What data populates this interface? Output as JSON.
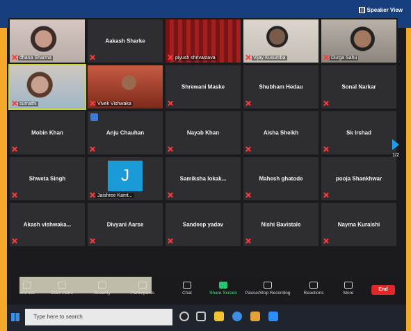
{
  "header": {
    "speaker_view_label": "Speaker View"
  },
  "tiles": [
    {
      "name": "dhana Sharma",
      "style": "vid1",
      "label_pos": "bottom"
    },
    {
      "name": "Aakash Sharke",
      "style": "dark",
      "label_pos": "center"
    },
    {
      "name": "piyush shrivastava",
      "style": "vid2",
      "label_pos": "bottom"
    },
    {
      "name": "Vijay Kusumba",
      "style": "vid4",
      "label_pos": "bottom"
    },
    {
      "name": "Durga Sahu",
      "style": "vid3",
      "label_pos": "bottom"
    },
    {
      "name": "sumathi",
      "style": "vid5",
      "label_pos": "bottom",
      "active": true
    },
    {
      "name": "Vivek Vishwaka",
      "style": "vid6",
      "label_pos": "bottom"
    },
    {
      "name": "Shrewani Maske",
      "style": "dark",
      "label_pos": "center"
    },
    {
      "name": "Shubham Hedau",
      "style": "dark",
      "label_pos": "center"
    },
    {
      "name": "Sonal Narkar",
      "style": "dark",
      "label_pos": "center"
    },
    {
      "name": "Mobin Khan",
      "style": "dark",
      "label_pos": "center"
    },
    {
      "name": "Anju Chauhan",
      "style": "dark",
      "label_pos": "center",
      "hand": true
    },
    {
      "name": "Nayab Khan",
      "style": "dark",
      "label_pos": "center"
    },
    {
      "name": "Aisha Sheikh",
      "style": "dark",
      "label_pos": "center"
    },
    {
      "name": "Sk Irshad",
      "style": "dark",
      "label_pos": "center"
    },
    {
      "name": "Shweta Singh",
      "style": "dark",
      "label_pos": "center"
    },
    {
      "name": "Jaishree Kamt...",
      "style": "avatar",
      "label_pos": "bottom",
      "avatar_letter": "J"
    },
    {
      "name": "Samiksha lokak...",
      "style": "dark",
      "label_pos": "center"
    },
    {
      "name": "Mahesh ghatode",
      "style": "dark",
      "label_pos": "center"
    },
    {
      "name": "pooja Shankhwar",
      "style": "dark",
      "label_pos": "center"
    },
    {
      "name": "Akash vishwaka...",
      "style": "dark",
      "label_pos": "center"
    },
    {
      "name": "Divyani Aarse",
      "style": "dark",
      "label_pos": "center"
    },
    {
      "name": "Sandeep yadav",
      "style": "dark",
      "label_pos": "center"
    },
    {
      "name": "Nishi Bavistale",
      "style": "dark",
      "label_pos": "center"
    },
    {
      "name": "Nayma Kuraishi",
      "style": "dark",
      "label_pos": "center"
    }
  ],
  "pager": {
    "page": "1/2"
  },
  "toolbar": {
    "unmute": "Unmute",
    "start_video": "Start Video",
    "security": "Security",
    "participants": "Participants",
    "chat": "Chat",
    "share_screen": "Share Screen",
    "recording": "Pause/Stop Recording",
    "reactions": "Reactions",
    "more": "More",
    "end": "End"
  },
  "taskbar": {
    "search_placeholder": "Type here to search"
  },
  "colors": {
    "accent_blue": "#1a9ad6",
    "share_green": "#28c76f",
    "end_red": "#e02828",
    "background_orange": "#f4a92a",
    "header_blue": "#173f7d"
  }
}
